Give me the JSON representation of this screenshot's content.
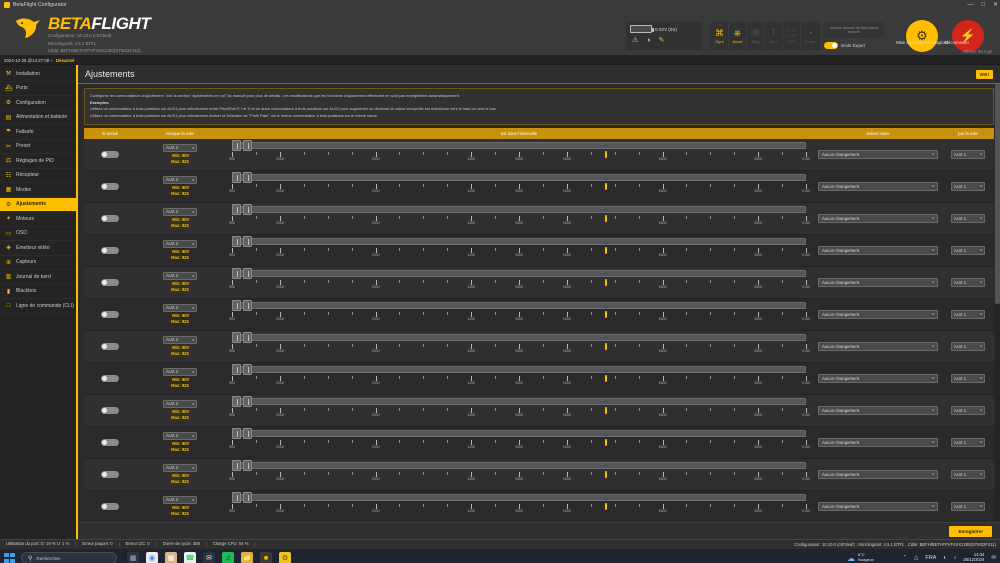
{
  "window": {
    "title": "BetaFlight Configurator",
    "minimize": "—",
    "maximize": "□",
    "close": "✕"
  },
  "brand": {
    "name_part1": "BETA",
    "name_part2": "FLIGHT",
    "line1": "Configurateur: 10.10.0 (c97deaf)",
    "line2": "Micrologiciel: 4.5.1 BTFL",
    "line3": "Cible: BEFH/BETAFPVF4SX1280(STM32F411)"
  },
  "header": {
    "battery_voltage": "0.02V (0S)",
    "battery_icons": [
      "⚠",
      "◑",
      "✎"
    ],
    "sensors": [
      {
        "name": "Gyro",
        "glyph": "⌘",
        "active": true
      },
      {
        "name": "Accel",
        "glyph": "⎈",
        "active": true
      },
      {
        "name": "Mag",
        "glyph": "Ⓝ",
        "active": false
      },
      {
        "name": "Baro",
        "glyph": "ᵀ",
        "active": false
      },
      {
        "name": "GPS",
        "glyph": "⛶",
        "active": false
      },
      {
        "name": "Sonar",
        "glyph": "◔",
        "active": false
      }
    ],
    "flash_notice": "Aucune donnée de flash pièce trouvée",
    "expert_label": "Mode Expert",
    "flash_button": "Mise à jour du micrologiciel",
    "flash_icon": "⚙",
    "disconnect_button": "Déconnecter",
    "disconnect_icon": "⚡",
    "show_log": "Afficher les logs"
  },
  "status_strip": {
    "datetime": "2024-12-25 @14:27:08 –",
    "state": "Désarmé"
  },
  "sidebar": {
    "items": [
      {
        "label": "Installation",
        "icon": "⚒",
        "active": false
      },
      {
        "label": "Ports",
        "icon": "⛴",
        "active": false
      },
      {
        "label": "Configuration",
        "icon": "⚙",
        "active": false
      },
      {
        "label": "Alimentation et batterie",
        "icon": "▤",
        "active": false
      },
      {
        "label": "Failsafe",
        "icon": "☂",
        "active": false
      },
      {
        "label": "Preset",
        "icon": "✂",
        "active": false
      },
      {
        "label": "Réglages de PID",
        "icon": "⚖",
        "active": false
      },
      {
        "label": "Récepteur",
        "icon": "☷",
        "active": false
      },
      {
        "label": "Modes",
        "icon": "▦",
        "active": false
      },
      {
        "label": "Ajustements",
        "icon": "⚙",
        "active": true
      },
      {
        "label": "Moteurs",
        "icon": "✶",
        "active": false
      },
      {
        "label": "OSD",
        "icon": "▭",
        "active": false
      },
      {
        "label": "Émetteur vidéo",
        "icon": "◈",
        "active": false
      },
      {
        "label": "Capteurs",
        "icon": "⊕",
        "active": false
      },
      {
        "label": "Journal de bord",
        "icon": "▥",
        "active": false
      },
      {
        "label": "Blackbox",
        "icon": "▮",
        "active": false
      },
      {
        "label": "Ligne de commande (CLI)",
        "icon": "□",
        "active": false
      }
    ]
  },
  "page": {
    "title": "Ajustements",
    "wiki_button": "WIKI",
    "help": [
      "Configurez les commutateurs d'ajustement. Voir la section \"ajustements en vol\" du manuel pour plus de détails. Les modifications que les fonctions d'ajustement effectuent ne sont pas enregistrées automatiquement.",
      "Exemples:",
      "Utilisez un commutateur à trois positions sur AUX1 pour sélectionner entre Pitch/Roll P, I et D et un autre commutateur à trois positions sur AUX2 pour augmenter ou diminuer la valeur lorsqu'elle est maintenue vers le haut ou vers le bas.",
      "Utilisez un commutateur à trois positions sur AUX1 pour sélectionner Activer la Sélection de \"Profil Rate\" via le même commutateur à trois positions sur le même canal."
    ],
    "columns": {
      "enabled": "Si activé",
      "channel": "lorsque la voie",
      "range": "est dans l'intervalle",
      "action": "activer alors",
      "via": "par la voie"
    },
    "save_button": "Enregistrer",
    "scale_ticks": [
      900,
      1000,
      1200,
      1400,
      1500,
      1600,
      1800,
      2000,
      2100
    ],
    "scale_min": 900,
    "scale_max": 2100,
    "dropdown_arrow": "▾",
    "rows": [
      {
        "enabled": false,
        "channel": "AUX 1",
        "min": "Min: 900",
        "max": "Max: 925",
        "range_start": 900,
        "range_end": 925,
        "marker": 1680,
        "action": "Aucun changement",
        "via": "AUX 1"
      },
      {
        "enabled": false,
        "channel": "AUX 1",
        "min": "Min: 900",
        "max": "Max: 925",
        "range_start": 900,
        "range_end": 925,
        "marker": 1680,
        "action": "Aucun changement",
        "via": "AUX 1"
      },
      {
        "enabled": false,
        "channel": "AUX 1",
        "min": "Min: 900",
        "max": "Max: 925",
        "range_start": 900,
        "range_end": 925,
        "marker": 1680,
        "action": "Aucun changement",
        "via": "AUX 1"
      },
      {
        "enabled": false,
        "channel": "AUX 1",
        "min": "Min: 900",
        "max": "Max: 925",
        "range_start": 900,
        "range_end": 925,
        "marker": 1680,
        "action": "Aucun changement",
        "via": "AUX 1"
      },
      {
        "enabled": false,
        "channel": "AUX 1",
        "min": "Min: 900",
        "max": "Max: 925",
        "range_start": 900,
        "range_end": 925,
        "marker": 1680,
        "action": "Aucun changement",
        "via": "AUX 1"
      },
      {
        "enabled": false,
        "channel": "AUX 1",
        "min": "Min: 900",
        "max": "Max: 925",
        "range_start": 900,
        "range_end": 925,
        "marker": 1680,
        "action": "Aucun changement",
        "via": "AUX 1"
      },
      {
        "enabled": false,
        "channel": "AUX 1",
        "min": "Min: 900",
        "max": "Max: 925",
        "range_start": 900,
        "range_end": 925,
        "marker": 1680,
        "action": "Aucun changement",
        "via": "AUX 1"
      },
      {
        "enabled": false,
        "channel": "AUX 1",
        "min": "Min: 900",
        "max": "Max: 925",
        "range_start": 900,
        "range_end": 925,
        "marker": 1680,
        "action": "Aucun changement",
        "via": "AUX 1"
      },
      {
        "enabled": false,
        "channel": "AUX 1",
        "min": "Min: 900",
        "max": "Max: 925",
        "range_start": 900,
        "range_end": 925,
        "marker": 1680,
        "action": "Aucun changement",
        "via": "AUX 1"
      },
      {
        "enabled": false,
        "channel": "AUX 1",
        "min": "Min: 900",
        "max": "Max: 925",
        "range_start": 900,
        "range_end": 925,
        "marker": 1680,
        "action": "Aucun changement",
        "via": "AUX 1"
      },
      {
        "enabled": false,
        "channel": "AUX 1",
        "min": "Min: 900",
        "max": "Max: 925",
        "range_start": 900,
        "range_end": 925,
        "marker": 1680,
        "action": "Aucun changement",
        "via": "AUX 1"
      },
      {
        "enabled": false,
        "channel": "AUX 1",
        "min": "Min: 900",
        "max": "Max: 925",
        "range_start": 900,
        "range_end": 925,
        "marker": 1680,
        "action": "Aucun changement",
        "via": "AUX 1"
      }
    ]
  },
  "app_status": {
    "items": [
      "Utilisation du port: D: 19 % U: 1 %",
      "Erreur paquet: 0",
      "Erreur I2C: 0",
      "Durée de cycle: 308",
      "Charge CPU: 54 %"
    ],
    "right": "Configurateur: 10.10.0 (c97deaf) , Micrologiciel: 4.5.1 BTFL , Cible: BEFH/BETAFPVF4SX1280(STM32F411)"
  },
  "taskbar": {
    "search_placeholder": "Rechercher",
    "weather_temp": "8°C",
    "weather_desc": "Nuageux",
    "time": "14:34",
    "date": "25/12/2024",
    "tray_icons": [
      "⌃",
      "△",
      "FRA",
      "◐",
      "♪"
    ]
  },
  "colors": {
    "accent": "#ffbf00",
    "header_band": "#c8920a",
    "danger": "#d2261a"
  }
}
